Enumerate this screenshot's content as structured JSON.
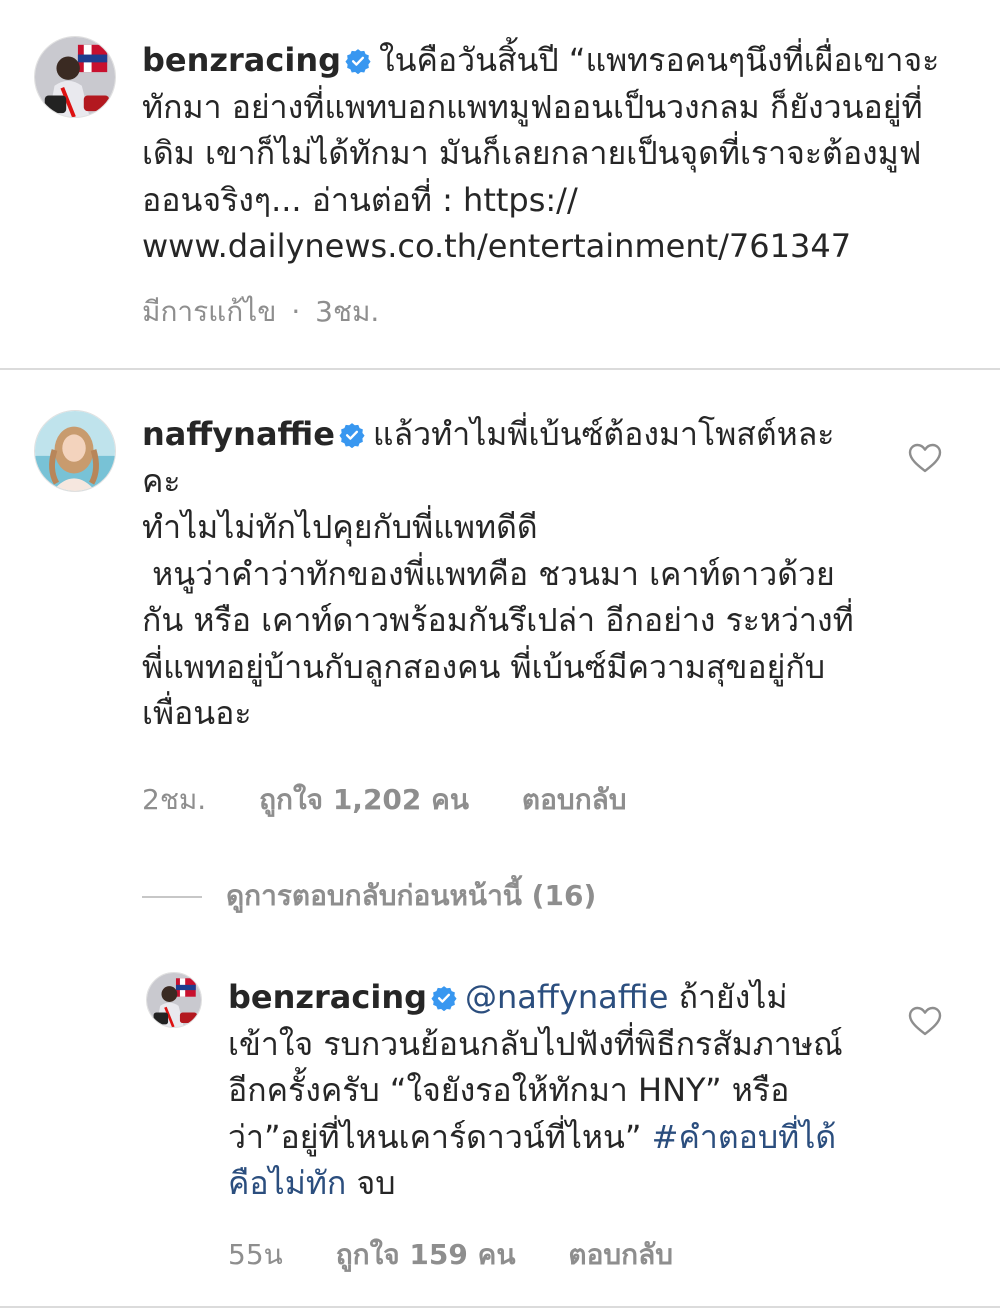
{
  "caption": {
    "username": "benzracing",
    "text": "ในคือวันสิ้นปี “แพทรอคนๆนึงที่เผื่อเขาจะทักมา อย่างที่แพทบอกแพทมูฟออนเป็นวงกลม ก็ยังวนอยู่ที่เดิม เขาก็ไม่ได้ทักมา มันก็เลยกลายเป็นจุดที่เราจะต้องมูฟออนจริงๆ... อ่านต่อที่ : https:// www.dailynews.co.th/entertainment/761347",
    "edited": "มีการแก้ไข",
    "separator": "·",
    "time": "3ชม."
  },
  "comment1": {
    "username": "naffynaffie",
    "paragraphs": [
      "แล้วทำไมพี่เบ้นซ์ต้องมาโพสต์หละคะ",
      "ทำไมไม่ทักไปคุยกับพี่แพทดีดี",
      " หนูว่าคำว่าทักของพี่แพทคือ ชวนมา เคาท์ดาวด้วยกัน หรือ เคาท์ดาวพร้อมกันรึเปล่า อีกอย่าง ระหว่างที่พี่แพทอยู่บ้านกับลูกสองคน พี่เบ้นซ์มีความสุขอยู่กับเพื่อนอะ"
    ],
    "time": "2ชม.",
    "likes": "ถูกใจ 1,202 คน",
    "reply": "ตอบกลับ"
  },
  "view_replies": "ดูการตอบกลับก่อนหน้านี้ (16)",
  "reply1": {
    "username": "benzracing",
    "mention": "@naffynaffie",
    "text": " ถ้ายังไม่เข้าใจ รบกวนย้อนกลับไปฟังที่พิธีกรสัมภาษณ์อีกครั้งครับ “ใจยังรอให้ทักมา HNY” หรือว่า”อยู่ที่ไหนเคาร์ดาวน์ที่ไหน”",
    "hashtag": "#คำตอบที่ได้คือไม่ทัก",
    "end": " จบ",
    "time": "55น",
    "likes": "ถูกใจ 159 คน",
    "reply": "ตอบกลับ"
  },
  "colors": {
    "text": "#262626",
    "secondary": "#8e8e8e",
    "link": "#2b4e7e",
    "verified": "#3897f0",
    "divider": "#dbdbdb"
  },
  "icons": {
    "verified": "verified-badge-icon",
    "like": "heart-outline-icon"
  }
}
